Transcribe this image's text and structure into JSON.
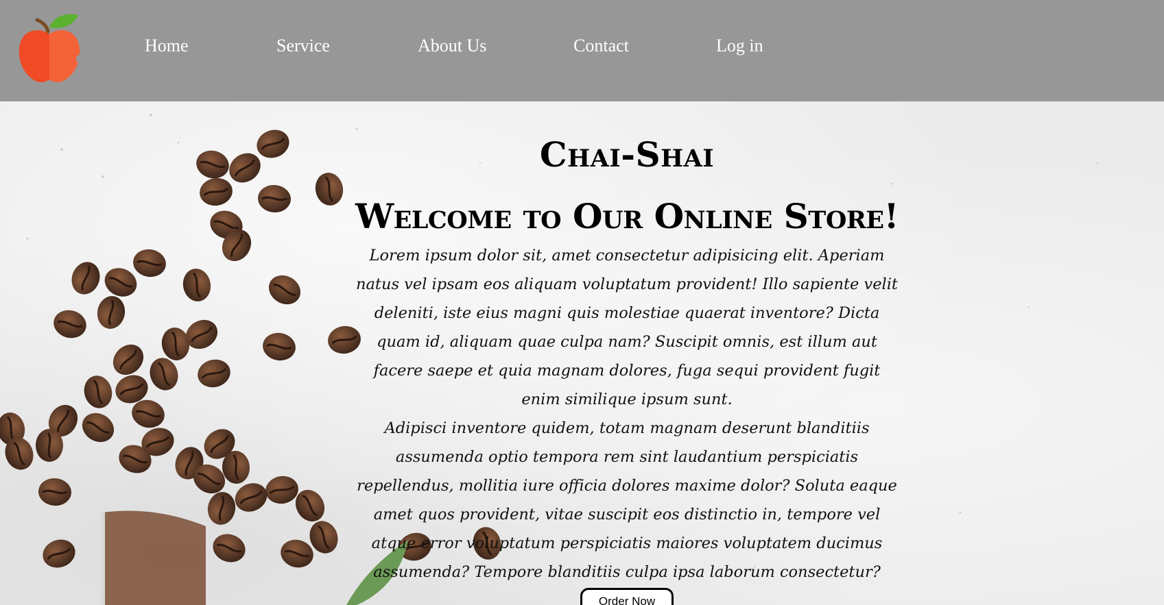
{
  "header": {
    "logo_icon": "apple-logo-icon",
    "background_color": "#979797",
    "nav": [
      {
        "label": "Home"
      },
      {
        "label": "Service"
      },
      {
        "label": "About Us"
      },
      {
        "label": "Contact"
      },
      {
        "label": "Log in"
      }
    ]
  },
  "hero": {
    "brand": "Chai-Shai",
    "heading": "Welcome to Our Online Store!",
    "paragraph_1": "Lorem ipsum dolor sit, amet consectetur adipisicing elit. Aperiam natus vel ipsam eos aliquam voluptatum provident! Illo sapiente velit deleniti, iste eius magni quis molestiae quaerat inventore? Dicta quam id, aliquam quae culpa nam? Suscipit omnis, est illum aut facere saepe et quia magnam dolores, fuga sequi provident fugit enim similique ipsum sunt.",
    "paragraph_2": "Adipisci inventore quidem, totam magnam deserunt blanditiis assumenda optio tempora rem sint laudantium perspiciatis repellendus, mollitia iure officia dolores maxime dolor? Soluta eaque amet quos provident, vitae suscipit eos distinctio in, tempore vel atque error voluptatum perspiciatis maiores voluptatem ducimus assumenda? Tempore blanditiis culpa ipsa laborum consectetur?",
    "order_button": "Order Now",
    "background_image": "coffee-beans-on-white-stone"
  },
  "colors": {
    "header": "#979797",
    "nav_text": "#ffffff",
    "apple_red": "#f04a26",
    "apple_leaf": "#5cb130"
  }
}
